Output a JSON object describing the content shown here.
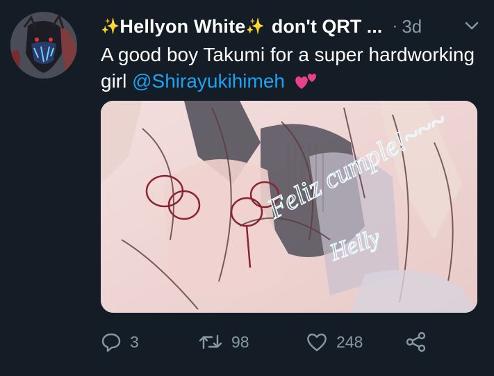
{
  "tweet": {
    "display_name_prefix": "✨",
    "display_name": "Hellyon White",
    "display_name_suffix": "✨",
    "name_extra": "don't QRT ...",
    "separator": "·",
    "timestamp": "3d",
    "text_before_mention": "A good boy Takumi for a super hardworking girl ",
    "mention": "@Shirayukihimeh",
    "emoji": "two-hearts-icon",
    "media": {
      "handwriting_line1": "Feliz cumple!~~~",
      "handwriting_line2": "Helly"
    },
    "actions": {
      "reply_count": "3",
      "retweet_count": "98",
      "like_count": "248"
    }
  },
  "colors": {
    "background": "#141d26",
    "text": "#ffffff",
    "muted": "#8899a6",
    "link": "#1da1f2",
    "sparkle": "#f5c542",
    "hearts": "#e6418a"
  }
}
